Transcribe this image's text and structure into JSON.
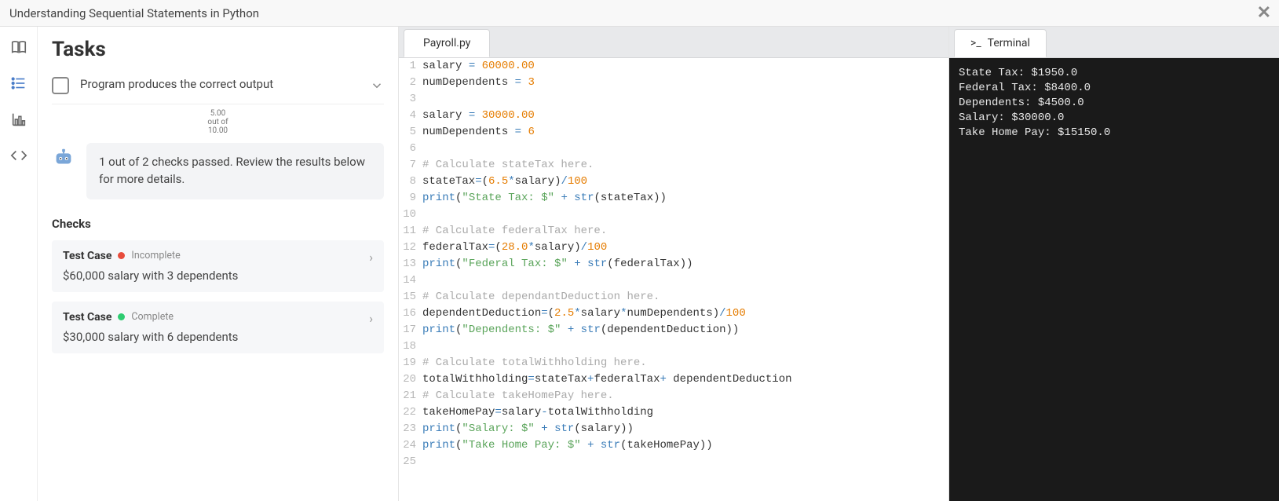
{
  "header": {
    "title": "Understanding Sequential Statements in Python"
  },
  "sidebar": {
    "icons": [
      "book-icon",
      "list-icon",
      "chart-icon",
      "code-icon"
    ]
  },
  "tasks": {
    "heading": "Tasks",
    "item": {
      "label": "Program produces the correct output",
      "score_num": "5.00",
      "score_mid": "out of",
      "score_den": "10.00"
    },
    "robot_msg": "1 out of 2 checks passed. Review the results below for more details.",
    "checks_heading": "Checks",
    "tests": [
      {
        "label": "Test Case",
        "status": "Incomplete",
        "dot": "red",
        "desc": "$60,000 salary with 3 dependents"
      },
      {
        "label": "Test Case",
        "status": "Complete",
        "dot": "green",
        "desc": "$30,000 salary with 6 dependents"
      }
    ]
  },
  "editor": {
    "tab": "Payroll.py",
    "lines": [
      [
        [
          "id",
          "salary "
        ],
        [
          "op",
          "="
        ],
        [
          "id",
          " "
        ],
        [
          "num",
          "60000.00"
        ]
      ],
      [
        [
          "id",
          "numDependents "
        ],
        [
          "op",
          "="
        ],
        [
          "id",
          " "
        ],
        [
          "num",
          "3"
        ]
      ],
      [],
      [
        [
          "id",
          "salary "
        ],
        [
          "op",
          "="
        ],
        [
          "id",
          " "
        ],
        [
          "num",
          "30000.00"
        ]
      ],
      [
        [
          "id",
          "numDependents "
        ],
        [
          "op",
          "="
        ],
        [
          "id",
          " "
        ],
        [
          "num",
          "6"
        ]
      ],
      [],
      [
        [
          "cmt",
          "# Calculate stateTax here."
        ]
      ],
      [
        [
          "id",
          "stateTax"
        ],
        [
          "op",
          "="
        ],
        [
          "id",
          "("
        ],
        [
          "num",
          "6.5"
        ],
        [
          "op",
          "*"
        ],
        [
          "id",
          "salary)"
        ],
        [
          "op",
          "/"
        ],
        [
          "num",
          "100"
        ]
      ],
      [
        [
          "kw",
          "print"
        ],
        [
          "id",
          "("
        ],
        [
          "str",
          "\"State Tax: $\""
        ],
        [
          "id",
          " "
        ],
        [
          "op",
          "+"
        ],
        [
          "id",
          " "
        ],
        [
          "kw",
          "str"
        ],
        [
          "id",
          "(stateTax))"
        ]
      ],
      [],
      [
        [
          "cmt",
          "# Calculate federalTax here."
        ]
      ],
      [
        [
          "id",
          "federalTax"
        ],
        [
          "op",
          "="
        ],
        [
          "id",
          "("
        ],
        [
          "num",
          "28.0"
        ],
        [
          "op",
          "*"
        ],
        [
          "id",
          "salary)"
        ],
        [
          "op",
          "/"
        ],
        [
          "num",
          "100"
        ]
      ],
      [
        [
          "kw",
          "print"
        ],
        [
          "id",
          "("
        ],
        [
          "str",
          "\"Federal Tax: $\""
        ],
        [
          "id",
          " "
        ],
        [
          "op",
          "+"
        ],
        [
          "id",
          " "
        ],
        [
          "kw",
          "str"
        ],
        [
          "id",
          "(federalTax))"
        ]
      ],
      [],
      [
        [
          "cmt",
          "# Calculate dependantDeduction here."
        ]
      ],
      [
        [
          "id",
          "dependentDeduction"
        ],
        [
          "op",
          "="
        ],
        [
          "id",
          "("
        ],
        [
          "num",
          "2.5"
        ],
        [
          "op",
          "*"
        ],
        [
          "id",
          "salary"
        ],
        [
          "op",
          "*"
        ],
        [
          "id",
          "numDependents)"
        ],
        [
          "op",
          "/"
        ],
        [
          "num",
          "100"
        ]
      ],
      [
        [
          "kw",
          "print"
        ],
        [
          "id",
          "("
        ],
        [
          "str",
          "\"Dependents: $\""
        ],
        [
          "id",
          " "
        ],
        [
          "op",
          "+"
        ],
        [
          "id",
          " "
        ],
        [
          "kw",
          "str"
        ],
        [
          "id",
          "(dependentDeduction))"
        ]
      ],
      [],
      [
        [
          "cmt",
          "# Calculate totalWithholding here."
        ]
      ],
      [
        [
          "id",
          "totalWithholding"
        ],
        [
          "op",
          "="
        ],
        [
          "id",
          "stateTax"
        ],
        [
          "op",
          "+"
        ],
        [
          "id",
          "federalTax"
        ],
        [
          "op",
          "+"
        ],
        [
          "id",
          " dependentDeduction"
        ]
      ],
      [
        [
          "cmt",
          "# Calculate takeHomePay here."
        ]
      ],
      [
        [
          "id",
          "takeHomePay"
        ],
        [
          "op",
          "="
        ],
        [
          "id",
          "salary"
        ],
        [
          "op",
          "-"
        ],
        [
          "id",
          "totalWithholding"
        ]
      ],
      [
        [
          "kw",
          "print"
        ],
        [
          "id",
          "("
        ],
        [
          "str",
          "\"Salary: $\""
        ],
        [
          "id",
          " "
        ],
        [
          "op",
          "+"
        ],
        [
          "id",
          " "
        ],
        [
          "kw",
          "str"
        ],
        [
          "id",
          "(salary))"
        ]
      ],
      [
        [
          "kw",
          "print"
        ],
        [
          "id",
          "("
        ],
        [
          "str",
          "\"Take Home Pay: $\""
        ],
        [
          "id",
          " "
        ],
        [
          "op",
          "+"
        ],
        [
          "id",
          " "
        ],
        [
          "kw",
          "str"
        ],
        [
          "id",
          "(takeHomePay))"
        ]
      ],
      []
    ]
  },
  "terminal": {
    "tab": "Terminal",
    "output": "State Tax: $1950.0\nFederal Tax: $8400.0\nDependents: $4500.0\nSalary: $30000.0\nTake Home Pay: $15150.0"
  }
}
